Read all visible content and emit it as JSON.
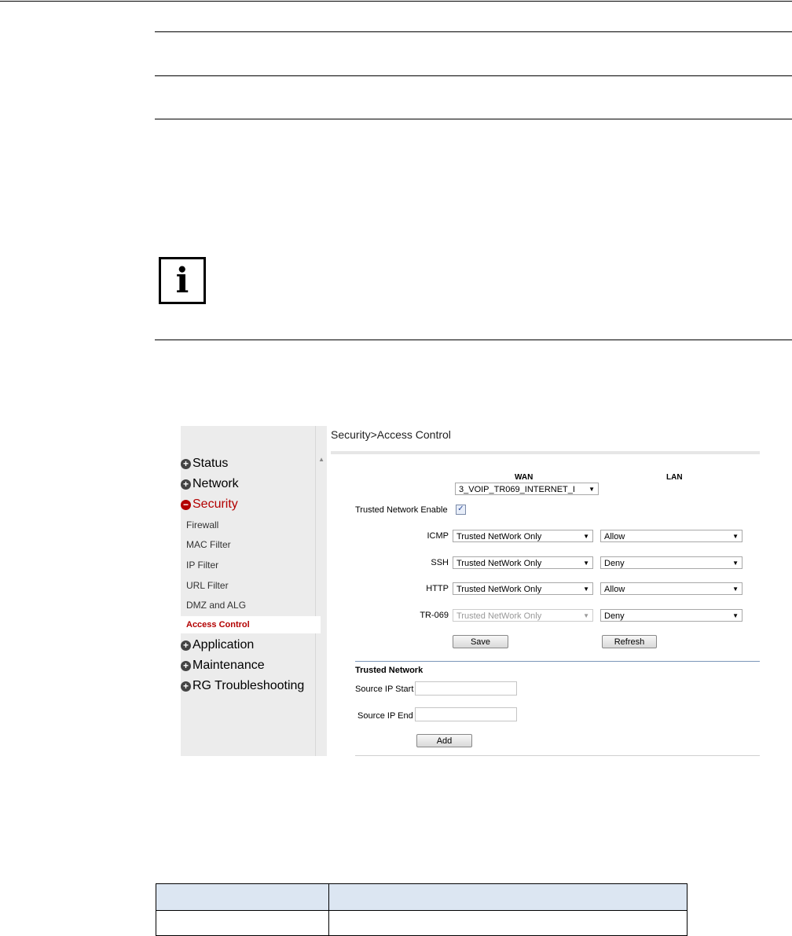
{
  "info_icon": {
    "glyph": "i"
  },
  "screenshot": {
    "breadcrumb": "Security>Access Control",
    "sidebar": {
      "top_items": [
        {
          "label": "Status",
          "state": "collapsed",
          "sign": "+"
        },
        {
          "label": "Network",
          "state": "collapsed",
          "sign": "+"
        },
        {
          "label": "Security",
          "state": "expanded",
          "sign": "−"
        }
      ],
      "sub_items": [
        {
          "label": "Firewall"
        },
        {
          "label": "MAC Filter"
        },
        {
          "label": "IP Filter"
        },
        {
          "label": "URL Filter"
        },
        {
          "label": "DMZ and ALG"
        },
        {
          "label": "Access Control",
          "active": true
        }
      ],
      "bottom_items": [
        {
          "label": "Application",
          "sign": "+"
        },
        {
          "label": "Maintenance",
          "sign": "+"
        },
        {
          "label": "RG Troubleshooting",
          "sign": "+"
        }
      ],
      "scroll_arrow": "▲"
    },
    "columns": {
      "wan": "WAN",
      "lan": "LAN"
    },
    "wan_select": "3_VOIP_TR069_INTERNET_I",
    "trusted_network_enable": {
      "label": "Trusted Network Enable",
      "checked": true,
      "mark": "✓"
    },
    "services": [
      {
        "name": "ICMP",
        "wan": "Trusted NetWork Only",
        "lan": "Allow",
        "wan_disabled": false
      },
      {
        "name": "SSH",
        "wan": "Trusted NetWork Only",
        "lan": "Deny",
        "wan_disabled": false
      },
      {
        "name": "HTTP",
        "wan": "Trusted NetWork Only",
        "lan": "Allow",
        "wan_disabled": false
      },
      {
        "name": "TR-069",
        "wan": "Trusted NetWork Only",
        "lan": "Deny",
        "wan_disabled": true
      }
    ],
    "buttons": {
      "save": "Save",
      "refresh": "Refresh",
      "add": "Add"
    },
    "trusted_network": {
      "title": "Trusted Network",
      "source_ip_start_label": "Source IP Start",
      "source_ip_start_value": "",
      "source_ip_end_label": "Source IP End",
      "source_ip_end_value": ""
    },
    "dropdown_arrow": "▼"
  },
  "table": {
    "header": [
      "",
      ""
    ],
    "rows": [
      [
        "",
        ""
      ]
    ]
  },
  "colors": {
    "accent_red": "#b30000",
    "table_header_bg": "#dce6f2",
    "sidebar_bg": "#ececec"
  }
}
